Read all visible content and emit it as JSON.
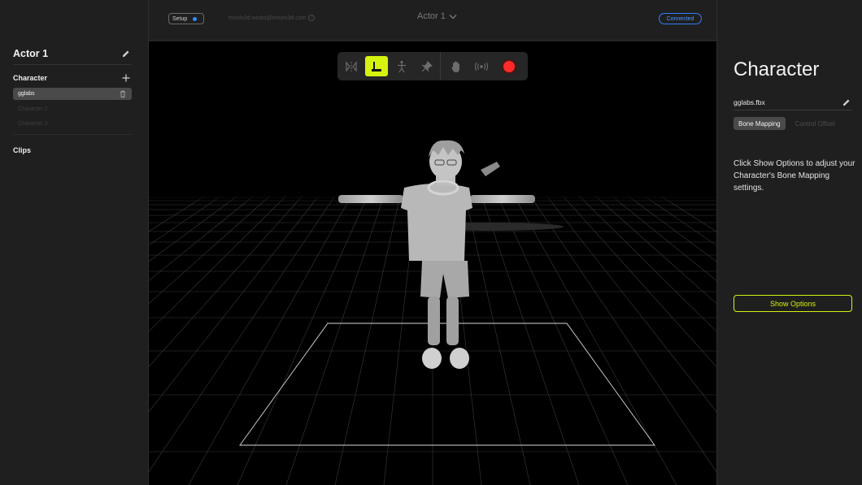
{
  "sidebar": {
    "actor_title": "Actor 1",
    "character_section": "Character",
    "characters": [
      {
        "label": "gglabs",
        "active": true
      },
      {
        "label": "Character 2",
        "active": false
      },
      {
        "label": "Character 3",
        "active": false
      }
    ],
    "clips_section": "Clips"
  },
  "topbar": {
    "setup_label": "Setup",
    "email": "movin3d.works@movin3d.com",
    "actor_select": "Actor 1",
    "status": "Connected"
  },
  "toolbar": {
    "tools": [
      "mirror-icon",
      "floor-icon",
      "skeleton-icon",
      "pin-icon",
      "hand-icon",
      "broadcast-icon",
      "record-icon"
    ],
    "active_tool": "floor-icon",
    "accent": "#d6f20f",
    "record_color": "#ff2b2b"
  },
  "panel": {
    "title": "Character",
    "file_name": "gglabs.fbx",
    "tabs": [
      "Bone Mapping",
      "Control Offset"
    ],
    "active_tab": "Bone Mapping",
    "help_text": "Click Show Options to adjust your Character's Bone Mapping settings.",
    "show_options": "Show Options"
  }
}
